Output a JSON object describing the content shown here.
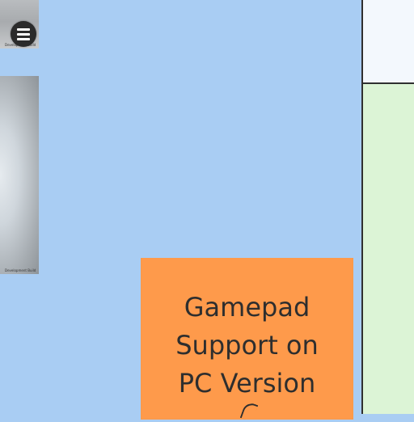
{
  "thumbnails": [
    {
      "caption": "Development Build"
    },
    {
      "caption": "Development Build"
    }
  ],
  "menu_button": {
    "icon": "hamburger-menu-icon"
  },
  "sticky_note": {
    "text": "Gamepad\nSupport on\nPC Version",
    "color": "#fe9a4b"
  },
  "colors": {
    "board": "#a9cdf3",
    "panel_top": "#f3f8fd",
    "panel_bottom": "#dcf4d6"
  }
}
